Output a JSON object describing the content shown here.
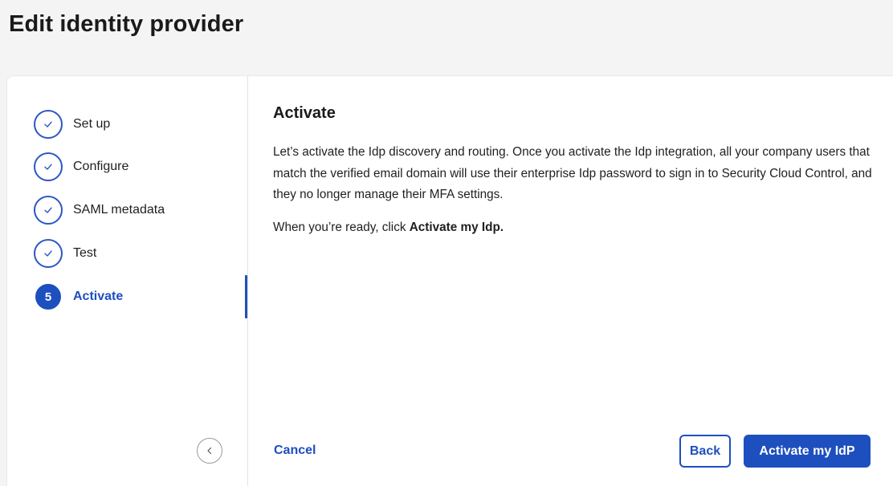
{
  "page": {
    "title": "Edit identity provider"
  },
  "stepper": {
    "steps": [
      {
        "label": "Set up",
        "state": "complete",
        "icon": "check-icon"
      },
      {
        "label": "Configure",
        "state": "complete",
        "icon": "check-icon"
      },
      {
        "label": "SAML metadata",
        "state": "complete",
        "icon": "check-icon"
      },
      {
        "label": "Test",
        "state": "complete",
        "icon": "check-icon"
      },
      {
        "label": "Activate",
        "state": "active",
        "number": "5"
      }
    ],
    "collapse_icon": "chevron-left-icon"
  },
  "content": {
    "title": "Activate",
    "description": "Let’s activate the Idp discovery and routing. Once you activate the Idp integration, all your company users that match the verified email domain will use their enterprise Idp password to sign in to Security Cloud Control, and they no longer manage their MFA settings.",
    "ready_prefix": "When you’re ready, click ",
    "ready_action": "Activate my Idp."
  },
  "footer": {
    "cancel_label": "Cancel",
    "back_label": "Back",
    "activate_label": "Activate my IdP"
  },
  "colors": {
    "accent": "#1d4fbf",
    "background": "#f4f4f4",
    "card": "#ffffff"
  }
}
